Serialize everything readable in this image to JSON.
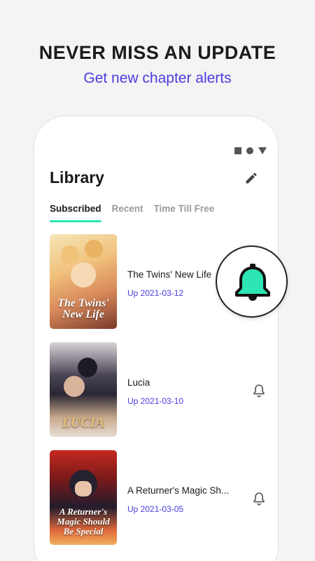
{
  "promo": {
    "headline": "NEVER MISS AN UPDATE",
    "subheadline": "Get new chapter alerts"
  },
  "library": {
    "title": "Library",
    "tabs": [
      {
        "label": "Subscribed",
        "active": true
      },
      {
        "label": "Recent",
        "active": false
      },
      {
        "label": "Time Till Free",
        "active": false
      }
    ],
    "items": [
      {
        "title": "The Twins' New Life",
        "date": "Up 2021-03-12",
        "cover_text": "The Twins' New Life",
        "cover_colors": [
          "#f3d9a2",
          "#b45c3a"
        ]
      },
      {
        "title": "Lucia",
        "date": "Up 2021-03-10",
        "cover_text": "LUCIA",
        "cover_colors": [
          "#3e3a48",
          "#c9b3a6"
        ]
      },
      {
        "title": "A Returner's Magic Sh...",
        "date": "Up 2021-03-05",
        "cover_text": "A Returner's Magic Should Be Special",
        "cover_colors": [
          "#b0241c",
          "#1e1b2e"
        ]
      }
    ]
  },
  "colors": {
    "accent": "#2ee6b5",
    "link": "#4a3ce0"
  },
  "icons": [
    "edit-icon",
    "bell-icon",
    "status-square-icon",
    "status-circle-icon",
    "status-triangle-icon"
  ]
}
